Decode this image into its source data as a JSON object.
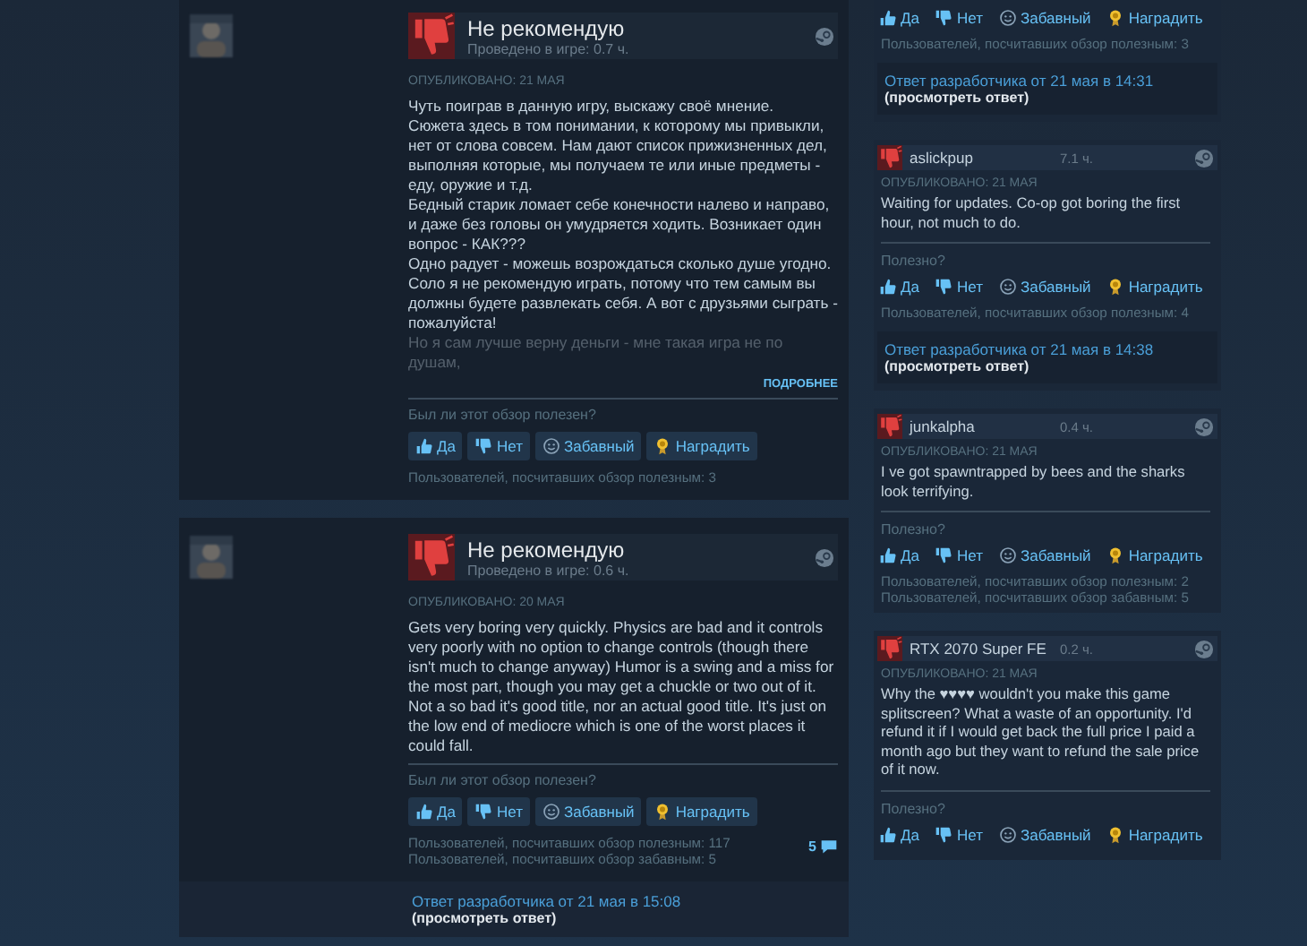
{
  "left_reviews": [
    {
      "recommendation": "Не рекомендую",
      "playtime": "Проведено в игре: 0.7 ч.",
      "posted": "ОПУБЛИКОВАНО: 21 МАЯ",
      "paragraphs": [
        "Чуть поиграв в данную игру, выскажу своё мнение.",
        "Сюжета здесь в том понимании, к которому мы привыкли, нет от слова совсем. Нам дают список прижизненных дел, выполняя которые, мы получаем те или иные предметы - еду, оружие и т.д.",
        "Бедный старик ломает себе конечности налево и направо, и даже без головы он умудряется ходить. Возникает один вопрос - КАК???",
        "Одно радует - можешь возрождаться сколько душе угодно.",
        "Соло я не рекомендую играть, потому что тем самым вы должны будете развлекать себя. А вот с друзьями сыграть - пожалуйста!"
      ],
      "faded_text": "Но я сам лучше верну деньги - мне такая игра не по душам,",
      "read_more": "ПОДРОБНЕЕ",
      "helpful_prompt": "Был ли этот обзор полезен?",
      "buttons": [
        {
          "kind": "yes",
          "label": "Да"
        },
        {
          "kind": "no",
          "label": "Нет"
        },
        {
          "kind": "funny",
          "label": "Забавный"
        },
        {
          "kind": "award",
          "label": "Наградить"
        }
      ],
      "counts": [
        "Пользователей, посчитавших обзор полезным: 3"
      ]
    },
    {
      "recommendation": "Не рекомендую",
      "playtime": "Проведено в игре: 0.6 ч.",
      "posted": "ОПУБЛИКОВАНО: 20 МАЯ",
      "paragraphs": [
        "Gets very boring very quickly. Physics are bad and it controls very poorly with no option to change controls (though there isn't much to change anyway) Humor is a swing and a miss for the most part, though you may get a chuckle or two out of it. Not a so bad it's good title, nor an actual good title. It's just on the low end of mediocre which is one of the worst places it could fall."
      ],
      "helpful_prompt": "Был ли этот обзор полезен?",
      "buttons": [
        {
          "kind": "yes",
          "label": "Да"
        },
        {
          "kind": "no",
          "label": "Нет"
        },
        {
          "kind": "funny",
          "label": "Забавный"
        },
        {
          "kind": "award",
          "label": "Наградить"
        }
      ],
      "counts": [
        "Пользователей, посчитавших обзор полезным: 117",
        "Пользователей, посчитавших обзор забавным: 5"
      ],
      "comments": "5",
      "developer_response": {
        "link": "Ответ разработчика от 21 мая в 15:08",
        "view": "(просмотреть ответ)"
      }
    }
  ],
  "right_reviews": [
    {
      "buttons": [
        {
          "kind": "yes",
          "label": "Да"
        },
        {
          "kind": "no",
          "label": "Нет"
        },
        {
          "kind": "funny",
          "label": "Забавный"
        },
        {
          "kind": "award",
          "label": "Наградить"
        }
      ],
      "counts": [
        "Пользователей, посчитавших обзор полезным: 3"
      ],
      "developer_response": {
        "link": "Ответ разработчика от 21 мая в 14:31",
        "view": "(просмотреть ответ)"
      }
    },
    {
      "name": "aslickpup",
      "playtime": "7.1 ч.",
      "posted": "ОПУБЛИКОВАНО: 21 МАЯ",
      "text": "Waiting for updates. Co-op got boring the first hour, not much to do.",
      "helpful_prompt": "Полезно?",
      "buttons": [
        {
          "kind": "yes",
          "label": "Да"
        },
        {
          "kind": "no",
          "label": "Нет"
        },
        {
          "kind": "funny",
          "label": "Забавный"
        },
        {
          "kind": "award",
          "label": "Наградить"
        }
      ],
      "counts": [
        "Пользователей, посчитавших обзор полезным: 4"
      ],
      "developer_response": {
        "link": "Ответ разработчика от 21 мая в 14:38",
        "view": "(просмотреть ответ)"
      }
    },
    {
      "name": "junkalpha",
      "playtime": "0.4 ч.",
      "posted": "ОПУБЛИКОВАНО: 21 МАЯ",
      "text": "I ve got spawntrapped by bees and the sharks look terrifying.",
      "helpful_prompt": "Полезно?",
      "buttons": [
        {
          "kind": "yes",
          "label": "Да"
        },
        {
          "kind": "no",
          "label": "Нет"
        },
        {
          "kind": "funny",
          "label": "Забавный"
        },
        {
          "kind": "award",
          "label": "Наградить"
        }
      ],
      "counts": [
        "Пользователей, посчитавших обзор полезным: 2",
        "Пользователей, посчитавших обзор забавным: 5"
      ]
    },
    {
      "name": "RTX 2070 Super FE",
      "playtime": "0.2 ч.",
      "posted": "ОПУБЛИКОВАНО: 21 МАЯ",
      "text": "Why the ♥♥♥♥ wouldn't you make this game splitscreen? What a waste of an opportunity. I'd refund it if I would get back the full price I paid a month ago but they want to refund the sale price of it now.",
      "helpful_prompt": "Полезно?",
      "buttons": [
        {
          "kind": "yes",
          "label": "Да"
        },
        {
          "kind": "no",
          "label": "Нет"
        },
        {
          "kind": "funny",
          "label": "Забавный"
        },
        {
          "kind": "award",
          "label": "Наградить"
        }
      ]
    }
  ]
}
